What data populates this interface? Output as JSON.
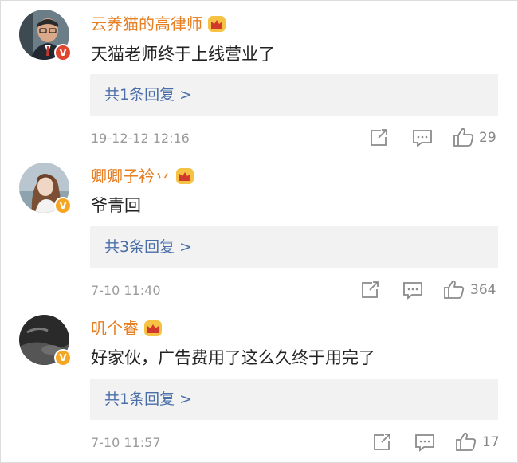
{
  "comments": [
    {
      "username": "云养猫的高律师",
      "text": "天猫老师终于上线营业了",
      "replies_label": "共1条回复 >",
      "time": "19-12-12 12:16",
      "likes": "29",
      "badge": "V",
      "badge_color": "#e0452f",
      "avatar_icon": "man-glasses-avatar"
    },
    {
      "username": "卿卿子衿丷",
      "text": "爷青回",
      "replies_label": "共3条回复 >",
      "time": "7-10 11:40",
      "likes": "364",
      "badge": "V",
      "badge_color": "#f5a623",
      "avatar_icon": "woman-long-hair-avatar"
    },
    {
      "username": "叽个睿",
      "text": "好家伙，广告费用了这么久终于用完了",
      "replies_label": "共1条回复 >",
      "time": "7-10 11:57",
      "likes": "17",
      "badge": "V",
      "badge_color": "#f5a623",
      "avatar_icon": "dark-photo-avatar"
    }
  ],
  "colors": {
    "username": "#e67e22",
    "reply_link": "#4a6ea8",
    "meta": "#9b9b9b",
    "reply_bg": "#f2f2f2"
  }
}
